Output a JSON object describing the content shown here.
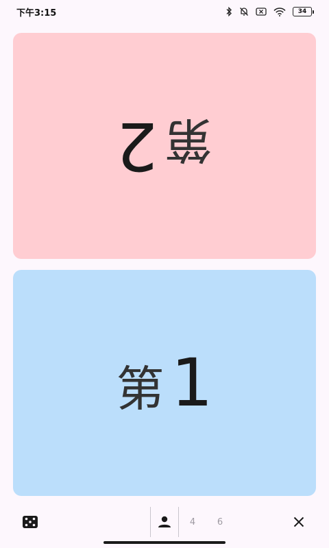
{
  "status_bar": {
    "time": "下午3:15",
    "battery": "34",
    "icons": [
      "bluetooth-icon",
      "mute-icon",
      "no-sim-icon",
      "wifi-icon",
      "battery-icon"
    ]
  },
  "cards": {
    "top": {
      "prefix": "第",
      "number": "2",
      "color": "#ffcdd2",
      "rotated": true
    },
    "bottom": {
      "prefix": "第",
      "number": "1",
      "color": "#bbdefb",
      "rotated": false
    }
  },
  "bottom_bar": {
    "left_icon": "dice-icon",
    "segment": {
      "selected_icon": "person-icon",
      "options": [
        "4",
        "6"
      ]
    },
    "right_icon": "close-icon"
  }
}
